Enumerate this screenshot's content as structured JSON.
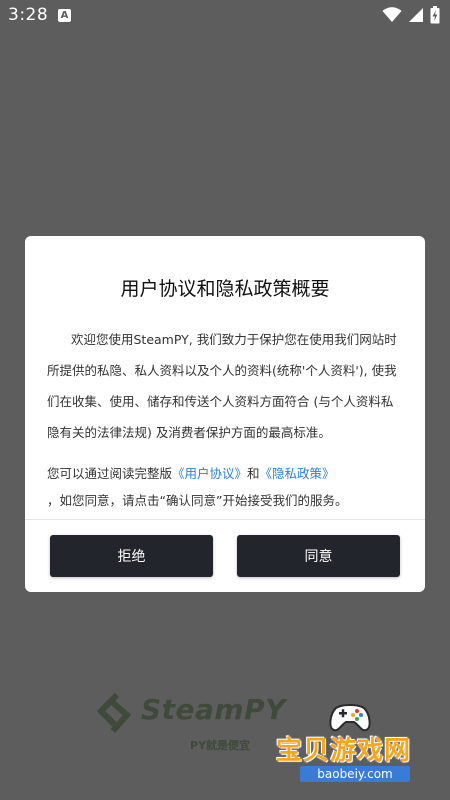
{
  "status_bar": {
    "time": "3:28",
    "notification_badge": "A"
  },
  "dialog": {
    "title": "用户协议和隐私政策概要",
    "intro": "欢迎您使用SteamPY, 我们致力于保护您在使用我们网站时所提供的私隐、私人资料以及个人的资料(统称'个人资料'), 使我们在收集、使用、储存和传送个人资料方面符合 (与个人资料私隐有关的法律法规) 及消费者保护方面的最高标准。",
    "agreement_prefix": "您可以通过阅读完整版",
    "user_agreement_link": "《用户协议》",
    "conjunction": "和",
    "privacy_policy_link": "《隐私政策》",
    "agreement_suffix": "，如您同意，请点击“确认同意”开始接受我们的服务。",
    "reject_label": "拒绝",
    "agree_label": "同意"
  },
  "background": {
    "brand_name": "SteamPY",
    "slogan": "PY就是便宜"
  },
  "watermark": {
    "title": "宝贝游戏网",
    "site": "baobeiy.com"
  },
  "colors": {
    "overlay": "#5d5d5d",
    "link": "#2b7fd8",
    "button": "#23252c",
    "watermark": "#f7a51b"
  }
}
